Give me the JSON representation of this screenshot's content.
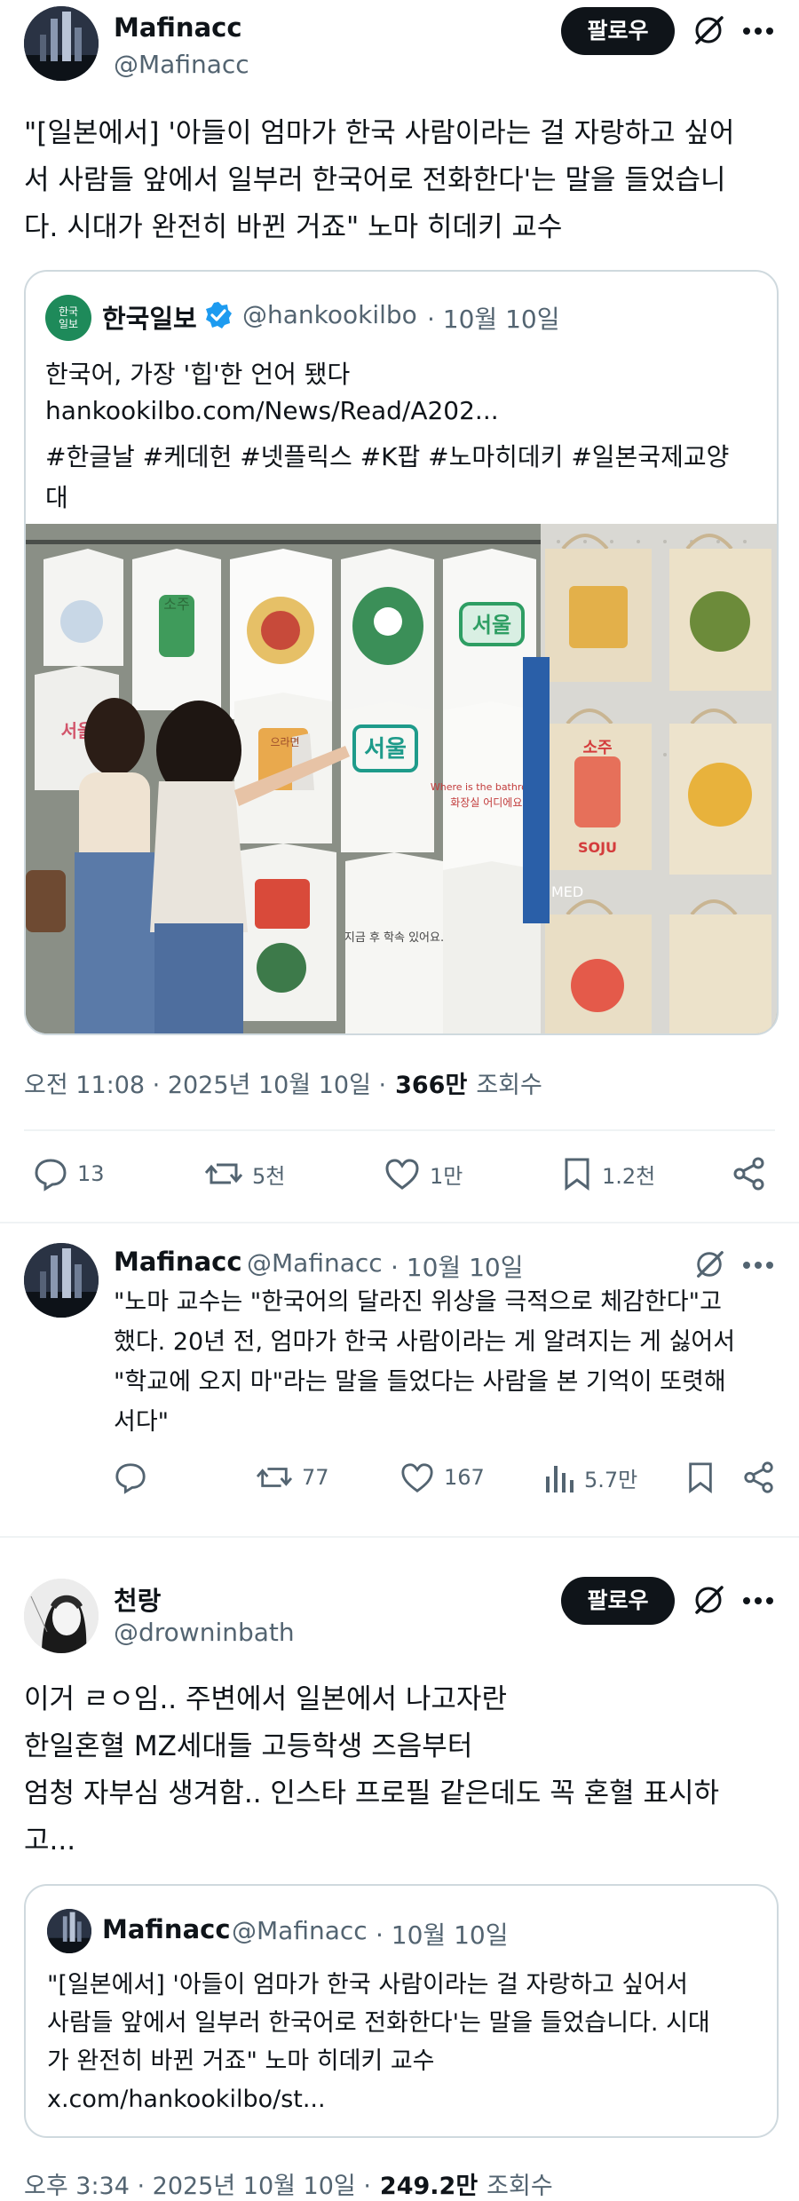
{
  "tweet1": {
    "author_name": "Mafinacc",
    "author_handle": "@Mafinacc",
    "follow_label": "팔로우",
    "text": "\"[일본에서] '아들이 엄마가 한국 사람이라는 걸 자랑하고 싶어\n서 사람들 앞에서 일부러 한국어로 전화한다'는 말을 들었습니\n다. 시대가 완전히 바뀐 거죠\" 노마 히데키 교수",
    "quote": {
      "logo_text": "한국\n일보",
      "name": "한국일보",
      "handle": "@hankookilbo",
      "date": "· 10월 10일",
      "line1": "한국어, 가장 '힙'한 언어 됐다",
      "line2": "hankookilbo.com/News/Read/A202...",
      "line3": "#한글날 #케데헌 #넷플릭스 #K팝 #노마히데키 #일본국제교양\n대",
      "shirt_texts": [
        "소주",
        "서울",
        "서울",
        "으라면",
        "소주",
        "SOJU",
        "Where is the bathroom?",
        "화장실 어디에요?",
        "지금 후 학속 있어요.",
        "MED"
      ]
    },
    "meta_time": "오전 11:08 · 2025년 10월 10일 ·",
    "meta_views_num": "366만",
    "meta_views_label": "조회수",
    "replies": "13",
    "reposts": "5천",
    "likes": "1만",
    "bookmarks": "1.2천"
  },
  "tweet2": {
    "author_name": "Mafinacc",
    "author_handle": "@Mafinacc",
    "date": "· 10월 10일",
    "text": "\"노마 교수는 \"한국어의 달라진 위상을 극적으로 체감한다\"고\n했다. 20년 전, 엄마가 한국 사람이라는 게 알려지는 게 싫어서\n\"학교에 오지 마\"라는 말을 들었다는 사람을 본 기억이 또렷해\n서다\"",
    "reposts": "77",
    "likes": "167",
    "views": "5.7만"
  },
  "tweet3": {
    "author_name": "천랑",
    "author_handle": "@drowninbath",
    "follow_label": "팔로우",
    "text": "이거 ㄹㅇ임.. 주변에서 일본에서 나고자란\n한일혼혈 MZ세대들 고등학생 즈음부터\n엄청 자부심 생겨함.. 인스타 프로필 같은데도 꼭 혼혈 표시하\n고...",
    "quote": {
      "name": "Mafinacc",
      "handle": "@Mafinacc",
      "date": "· 10월 10일",
      "text": "\"[일본에서] '아들이 엄마가 한국 사람이라는 걸 자랑하고 싶어서\n사람들 앞에서 일부러 한국어로 전화한다'는 말을 들었습니다. 시대\n가 완전히 바뀐 거죠\" 노마 히데키 교수\nx.com/hankookilbo/st..."
    },
    "meta_time": "오후 3:34 · 2025년 10월 10일 ·",
    "meta_views_num": "249.2만",
    "meta_views_label": "조회수"
  },
  "colors": {
    "text": "#0f1419",
    "muted": "#536471",
    "border": "#cfd9de",
    "verified": "#1d9bf0",
    "brand_green": "#1e8a5a"
  }
}
